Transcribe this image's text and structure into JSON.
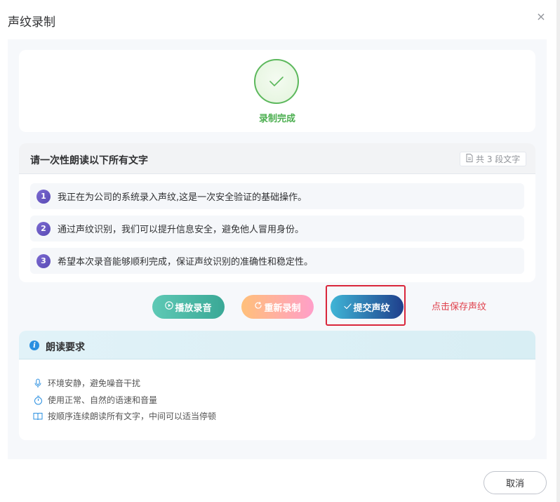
{
  "dialog": {
    "title": "声纹录制",
    "close_symbol": "×"
  },
  "status": {
    "text": "录制完成",
    "icon": "check-icon",
    "color": "#4caf50"
  },
  "reading": {
    "title": "请一次性朗读以下所有文字",
    "count_label": "共 3 段文字",
    "sentences": [
      {
        "num": "1",
        "text": "我正在为公司的系统录入声纹,这是一次安全验证的基础操作。"
      },
      {
        "num": "2",
        "text": "通过声纹识别，我们可以提升信息安全，避免他人冒用身份。"
      },
      {
        "num": "3",
        "text": "希望本次录音能够顺利完成，保证声纹识别的准确性和稳定性。"
      }
    ]
  },
  "actions": {
    "play_label": "播放录音",
    "redo_label": "重新录制",
    "submit_label": "提交声纹",
    "hint": "点击保存声纹",
    "hint_color": "#e0414c"
  },
  "requirements": {
    "title": "朗读要求",
    "items": [
      {
        "icon": "microphone-icon",
        "text": "环境安静，避免噪音干扰"
      },
      {
        "icon": "timer-icon",
        "text": "使用正常、自然的语速和音量"
      },
      {
        "icon": "book-icon",
        "text": "按顺序连续朗读所有文字，中间可以适当停顿"
      }
    ]
  },
  "footer": {
    "cancel_label": "取消"
  }
}
